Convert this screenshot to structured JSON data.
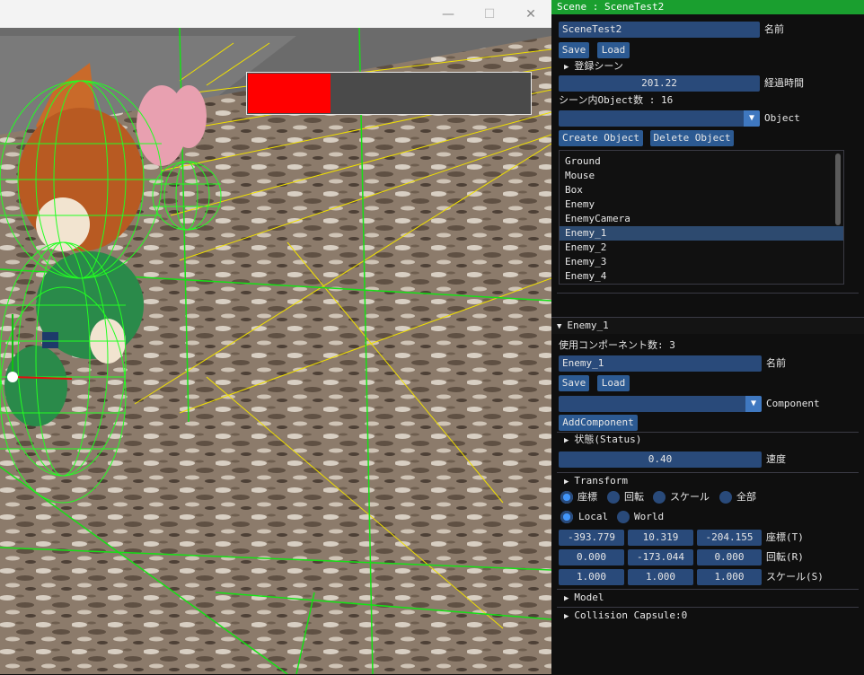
{
  "window": {
    "minimize": "—",
    "maximize": "☐",
    "close": "✕"
  },
  "hud": {
    "health_fraction": 0.29
  },
  "scene_panel": {
    "title": "Scene : SceneTest2",
    "name_value": "SceneTest2",
    "name_label": "名前",
    "save": "Save",
    "load": "Load",
    "registered_scenes": "登録シーン",
    "elapsed_value": "201.22",
    "elapsed_label": "経過時間",
    "object_count": "シーン内Object数 : 16",
    "object_label": "Object",
    "create_object": "Create Object",
    "delete_object": "Delete Object",
    "objects": [
      "Ground",
      "Mouse",
      "Box",
      "Enemy",
      "EnemyCamera",
      "Enemy_1",
      "Enemy_2",
      "Enemy_3",
      "Enemy_4"
    ],
    "selected_index": 5
  },
  "enemy_panel": {
    "title": "Enemy_1",
    "component_count": "使用コンポーネント数: 3",
    "name_value": "Enemy_1",
    "name_label": "名前",
    "save": "Save",
    "load": "Load",
    "component_label": "Component",
    "add_component": "AddComponent",
    "status_header": "状態(Status)",
    "speed_value": "0.40",
    "speed_label": "速度",
    "transform_header": "Transform",
    "radio_modes": [
      "座標",
      "回転",
      "スケール",
      "全部"
    ],
    "space_modes": [
      "Local",
      "World"
    ],
    "position": {
      "x": "-393.779",
      "y": "10.319",
      "z": "-204.155",
      "label": "座標(T)"
    },
    "rotation": {
      "x": "0.000",
      "y": "-173.044",
      "z": "0.000",
      "label": "回転(R)"
    },
    "scale": {
      "x": "1.000",
      "y": "1.000",
      "z": "1.000",
      "label": "スケール(S)"
    },
    "model_header": "Model",
    "collision_header": "Collision Capsule:0"
  }
}
